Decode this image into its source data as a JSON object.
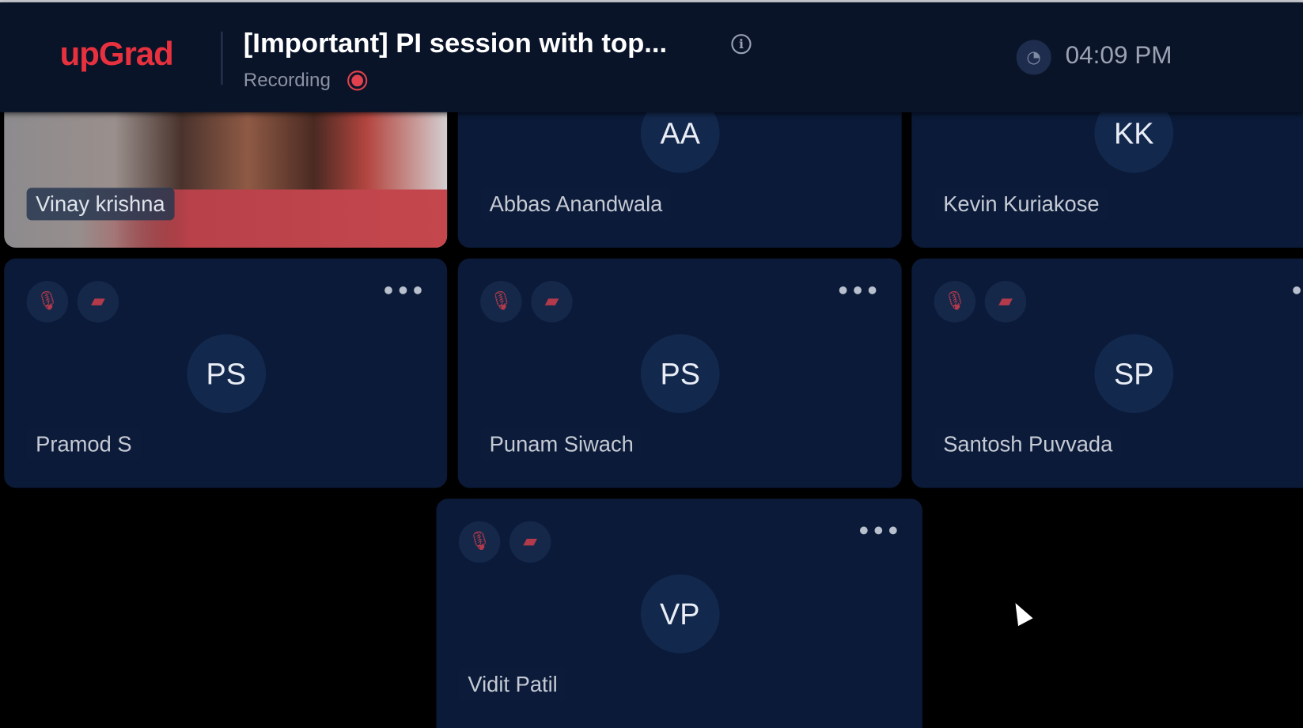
{
  "header": {
    "logo": "upGrad",
    "title": "[Important] PI session with top...",
    "info_icon": "i",
    "recording_label": "Recording",
    "time": "04:09 PM"
  },
  "participants": [
    {
      "name": "Vinay krishna",
      "video": true
    },
    {
      "name": "Abbas Anandwala",
      "initials": "AA"
    },
    {
      "name": "Kevin Kuriakose",
      "initials": "KK"
    },
    {
      "name": "Pramod S",
      "initials": "PS",
      "mic_muted": true,
      "camera_off": true
    },
    {
      "name": "Punam Siwach",
      "initials": "PS",
      "mic_muted": true,
      "camera_off": true
    },
    {
      "name": "Santosh Puvvada",
      "initials": "SP",
      "mic_muted": true,
      "camera_off": true
    },
    {
      "name": "Vidit Patil",
      "initials": "VP",
      "mic_muted": true,
      "camera_off": true
    }
  ],
  "more_label": "•••",
  "colors": {
    "brand": "#e8313f",
    "tile": "#0a1a38",
    "header": "#0a1429",
    "muted": "#b23a4a"
  }
}
